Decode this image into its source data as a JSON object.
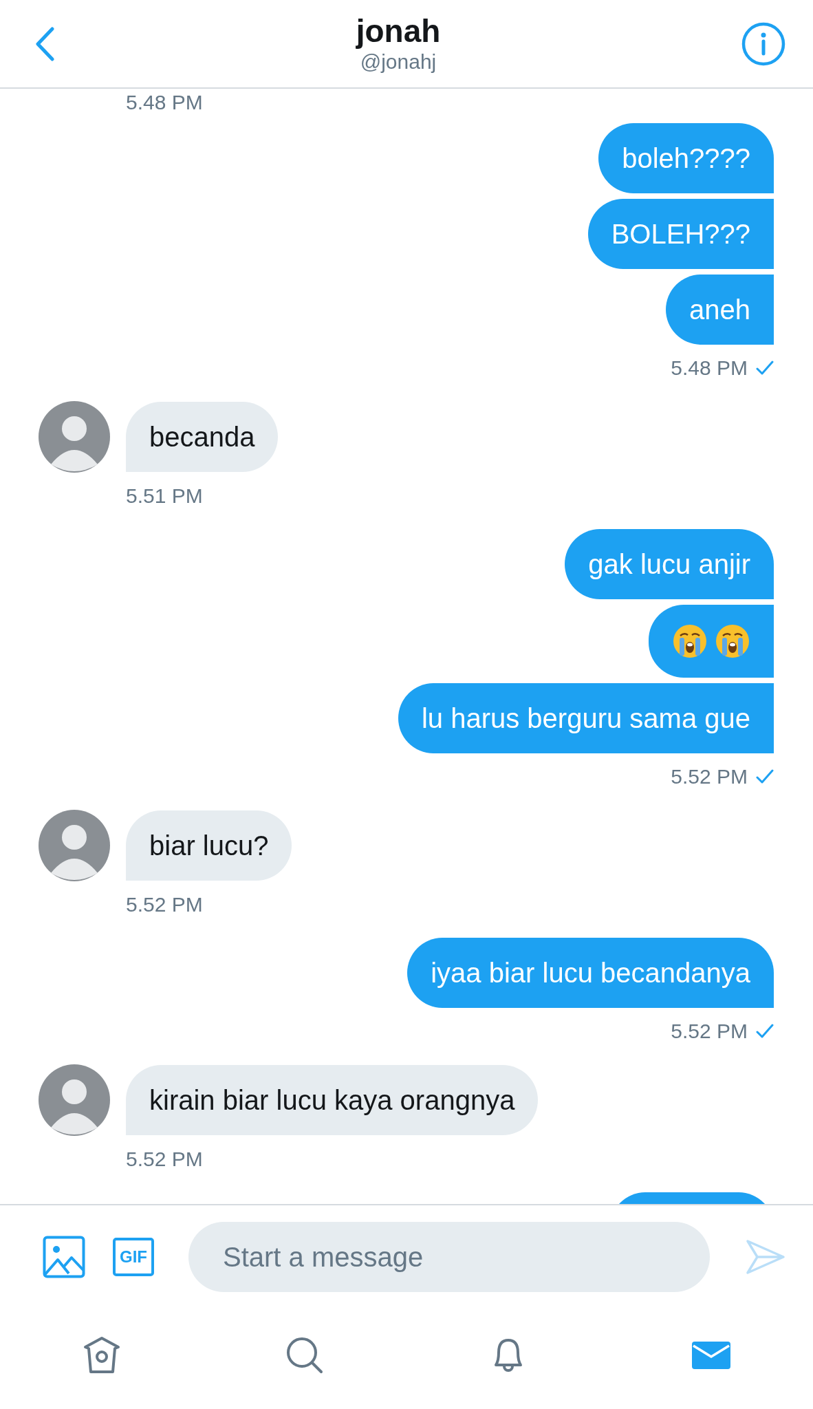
{
  "header": {
    "title": "jonah",
    "handle": "@jonahj"
  },
  "thread": [
    {
      "kind": "timestamp",
      "outgoing": false,
      "text": "5.48 PM"
    },
    {
      "kind": "text",
      "outgoing": true,
      "text": "boleh????"
    },
    {
      "kind": "text",
      "outgoing": true,
      "text": "BOLEH???"
    },
    {
      "kind": "text",
      "outgoing": true,
      "text": "aneh"
    },
    {
      "kind": "timestamp",
      "outgoing": true,
      "text": "5.48 PM",
      "read": true
    },
    {
      "kind": "text",
      "outgoing": false,
      "text": "becanda"
    },
    {
      "kind": "timestamp",
      "outgoing": false,
      "text": "5.51 PM"
    },
    {
      "kind": "text",
      "outgoing": true,
      "text": "gak lucu anjir"
    },
    {
      "kind": "emoji",
      "outgoing": true,
      "emojis": [
        {
          "kind": "crying"
        },
        {
          "kind": "crying"
        }
      ]
    },
    {
      "kind": "text",
      "outgoing": true,
      "text": "lu harus berguru sama gue"
    },
    {
      "kind": "timestamp",
      "outgoing": true,
      "text": "5.52 PM",
      "read": true
    },
    {
      "kind": "text",
      "outgoing": false,
      "text": "biar lucu?"
    },
    {
      "kind": "timestamp",
      "outgoing": false,
      "text": "5.52 PM"
    },
    {
      "kind": "text",
      "outgoing": true,
      "text": "iyaa biar lucu becandanya"
    },
    {
      "kind": "timestamp",
      "outgoing": true,
      "text": "5.52 PM",
      "read": true
    },
    {
      "kind": "text",
      "outgoing": false,
      "text": "kirain biar lucu kaya orangnya"
    },
    {
      "kind": "timestamp",
      "outgoing": false,
      "text": "5.52 PM"
    },
    {
      "kind": "partial",
      "outgoing": true
    }
  ],
  "composer": {
    "placeholder": "Start a message",
    "gif_label": "GIF"
  },
  "nav": [
    {
      "kind": "home",
      "selected": false
    },
    {
      "kind": "search",
      "selected": false
    },
    {
      "kind": "notifications",
      "selected": false
    },
    {
      "kind": "messages",
      "selected": true
    }
  ]
}
